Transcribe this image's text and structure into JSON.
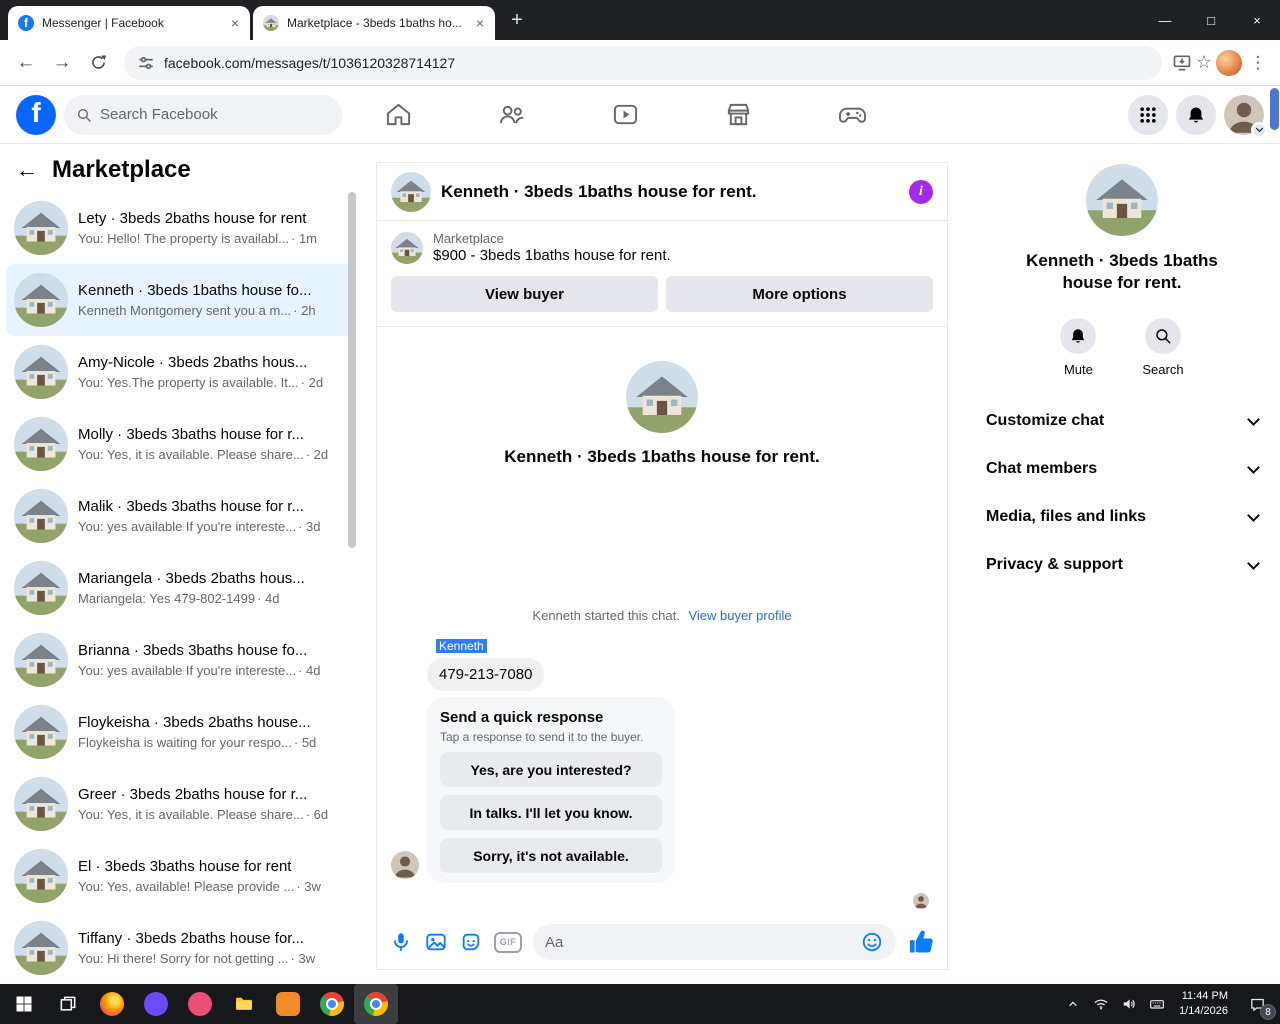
{
  "colors": {
    "fb-blue": "#0866ff",
    "accent": "#0a7cff",
    "link": "#216fdb",
    "info": "#a22beb",
    "selection": "#2e7df6",
    "selected-chat": "#e7f3ff",
    "scroll-blue": "#4b77cf"
  },
  "browser": {
    "tab1": "Messenger | Facebook",
    "tab2": "Marketplace - 3beds 1baths ho...",
    "url": "facebook.com/messages/t/1036120328714127"
  },
  "fb": {
    "logo_letter": "f",
    "search_placeholder": "Search Facebook"
  },
  "sidebar": {
    "title": "Marketplace",
    "conversations": [
      {
        "title": "Lety · 3beds 2baths house for rent",
        "preview": "You: Hello! The property is availabl...",
        "time": "· 1m"
      },
      {
        "title": "Kenneth · 3beds 1baths house fo...",
        "preview": "Kenneth Montgomery sent you a m...",
        "time": "· 2h"
      },
      {
        "title": "Amy-Nicole · 3beds 2baths hous...",
        "preview": "You: Yes.The property is available. It...",
        "time": "· 2d"
      },
      {
        "title": "Molly · 3beds 3baths house for r...",
        "preview": "You: Yes, it is available. Please share...",
        "time": "· 2d"
      },
      {
        "title": "Malik · 3beds 3baths house for r...",
        "preview": "You: yes available If you're intereste...",
        "time": "· 3d"
      },
      {
        "title": "Mariangela · 3beds 2baths hous...",
        "preview": "Mariangela: Yes 479-802-1499",
        "time": "· 4d"
      },
      {
        "title": "Brianna · 3beds 3baths house fo...",
        "preview": "You: yes available If you're intereste...",
        "time": "· 4d"
      },
      {
        "title": "Floykeisha · 3beds 2baths house...",
        "preview": "Floykeisha is waiting for your respo...",
        "time": "· 5d"
      },
      {
        "title": "Greer · 3beds 2baths house for r...",
        "preview": "You: Yes, it is available. Please share...",
        "time": "· 6d"
      },
      {
        "title": "El · 3beds 3baths house for rent",
        "preview": "You: Yes, available! Please provide ...",
        "time": "· 3w"
      },
      {
        "title": "Tiffany · 3beds 2baths house for...",
        "preview": "You: Hi there! Sorry for not getting ...",
        "time": "· 3w"
      }
    ]
  },
  "chat": {
    "title": "Kenneth · 3beds 1baths house for rent.",
    "source": "Marketplace",
    "listing": "$900 - 3beds 1baths house for rent.",
    "view_buyer": "View buyer",
    "more_options": "More options",
    "intro_title": "Kenneth · 3beds 1baths house for rent.",
    "started": "Kenneth started this chat.",
    "view_profile": "View buyer profile",
    "sender": "Kenneth",
    "message": "479-213-7080",
    "quick_title": "Send a quick response",
    "quick_sub": "Tap a response to send it to the buyer.",
    "quick_options": [
      "Yes, are you interested?",
      "In talks. I'll let you know.",
      "Sorry, it's not available."
    ],
    "gif_label": "GIF",
    "composer_placeholder": "Aa"
  },
  "panel": {
    "title": "Kenneth · 3beds 1baths house for rent.",
    "mute_label": "Mute",
    "search_label": "Search",
    "menu": [
      {
        "label": "Customize chat"
      },
      {
        "label": "Chat members"
      },
      {
        "label": "Media, files and links"
      },
      {
        "label": "Privacy & support"
      }
    ]
  },
  "taskbar": {
    "time": "11:44 PM",
    "date": "1/14/2026",
    "badge": "8"
  }
}
